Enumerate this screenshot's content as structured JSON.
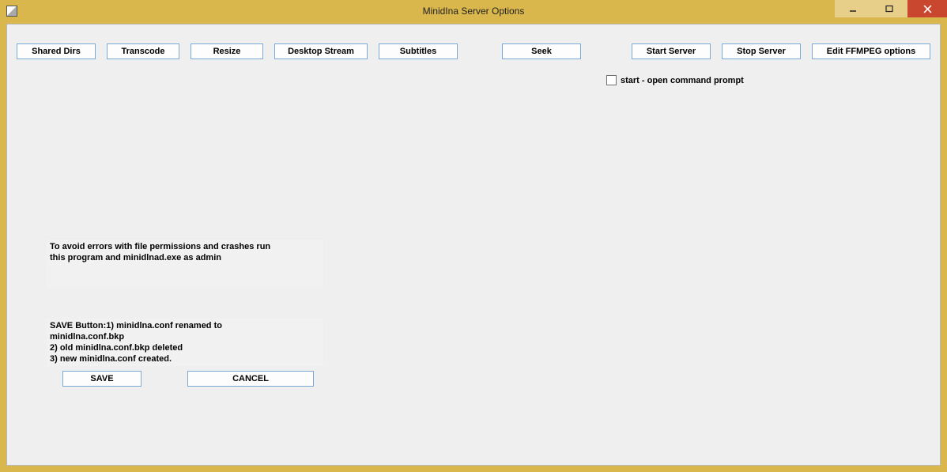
{
  "window": {
    "title": "MinidIna Server Options"
  },
  "toolbar": {
    "shared_dirs": "Shared Dirs",
    "transcode": "Transcode",
    "resize": "Resize",
    "desktop_stream": "Desktop Stream",
    "subtitles": "Subtitles",
    "seek": "Seek",
    "start_server": "Start Server",
    "stop_server": "Stop Server",
    "edit_ffmpeg": "Edit FFMPEG options"
  },
  "options": {
    "open_cmd_label": "start - open command prompt"
  },
  "info": {
    "permissions": "To avoid errors with file permissions and crashes run\nthis program and minidlnad.exe as admin",
    "save_steps": "SAVE Button:1) minidlna.conf renamed to\nminidlna.conf.bkp\n2) old minidlna.conf.bkp deleted\n3) new minidlna.conf created."
  },
  "footer": {
    "save": "SAVE",
    "cancel": "CANCEL"
  }
}
